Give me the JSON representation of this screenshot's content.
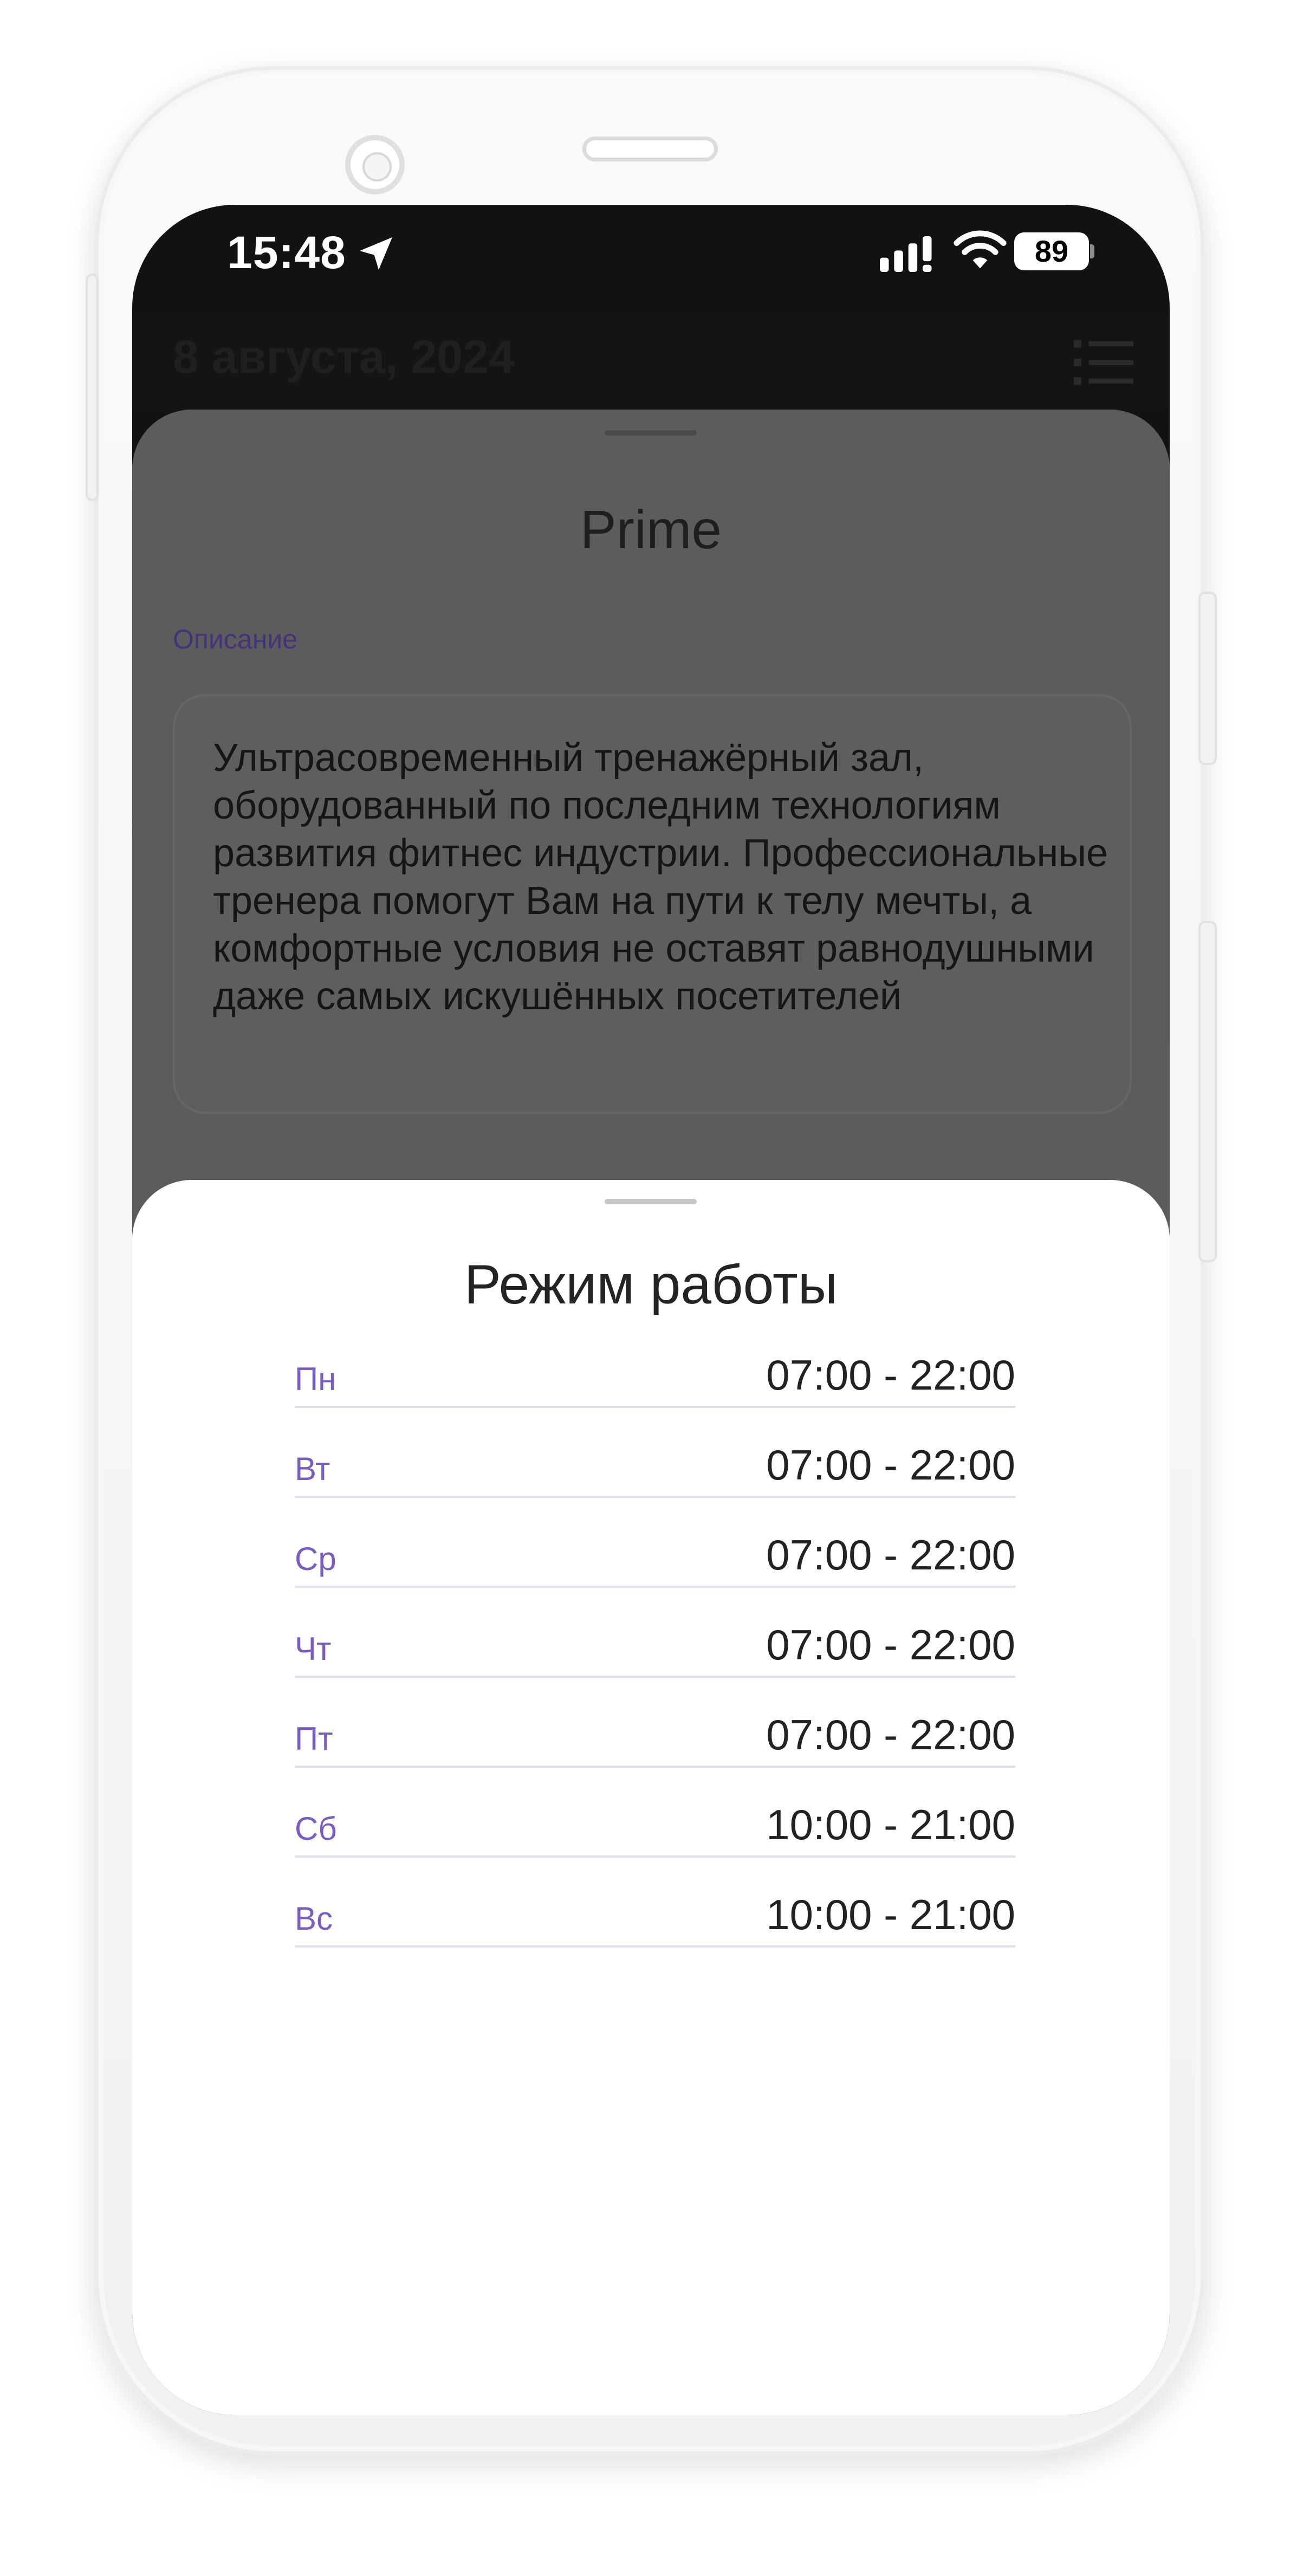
{
  "status_bar": {
    "time": "15:48",
    "battery": "89"
  },
  "header": {
    "date_title": "8 августа, 2024"
  },
  "venue": {
    "name": "Prime",
    "description_label": "Описание",
    "description": "Ультрасовременный тренажёрный зал, оборудованный по последним технологиям развития фитнес индустрии. Профессиональные тренера помогут Вам на пути к телу мечты, а комфортные условия не оставят равнодушными даже самых искушённых посетителей"
  },
  "schedule": {
    "title": "Режим работы",
    "days": [
      {
        "day": "Пн",
        "hours": "07:00 - 22:00"
      },
      {
        "day": "Вт",
        "hours": "07:00 - 22:00"
      },
      {
        "day": "Ср",
        "hours": "07:00 - 22:00"
      },
      {
        "day": "Чт",
        "hours": "07:00 - 22:00"
      },
      {
        "day": "Пт",
        "hours": "07:00 - 22:00"
      },
      {
        "day": "Сб",
        "hours": "10:00 - 21:00"
      },
      {
        "day": "Вс",
        "hours": "10:00 - 21:00"
      }
    ]
  },
  "colors": {
    "accent": "#7b5cc4",
    "screen_dim": "#5c5c5c",
    "sheet": "#ffffff"
  },
  "icons": {
    "location": "location-arrow-icon",
    "signal": "cellular-signal-icon",
    "wifi": "wifi-icon",
    "battery": "battery-icon",
    "menu": "list-menu-icon"
  }
}
